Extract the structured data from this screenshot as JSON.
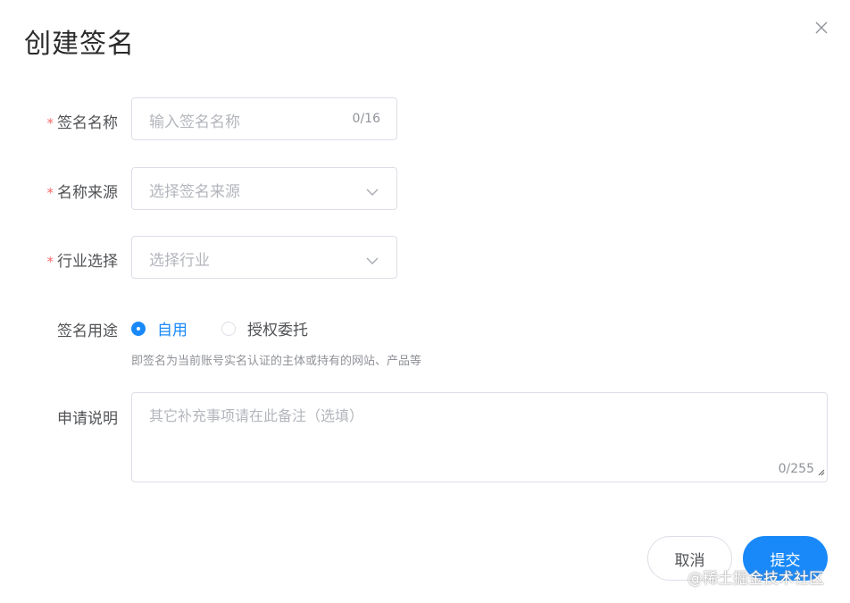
{
  "dialog": {
    "title": "创建签名"
  },
  "form": {
    "name": {
      "label": "签名名称",
      "placeholder": "输入签名名称",
      "counter": "0/16",
      "required": true
    },
    "source": {
      "label": "名称来源",
      "placeholder": "选择签名来源",
      "required": true
    },
    "industry": {
      "label": "行业选择",
      "placeholder": "选择行业",
      "required": true
    },
    "usage": {
      "label": "签名用途",
      "options": [
        {
          "label": "自用",
          "checked": true
        },
        {
          "label": "授权委托",
          "checked": false
        }
      ],
      "hint": "即签名为当前账号实名认证的主体或持有的网站、产品等"
    },
    "description": {
      "label": "申请说明",
      "placeholder": "其它补充事项请在此备注（选填）",
      "counter": "0/255"
    },
    "required_mark": "*"
  },
  "footer": {
    "cancel_label": "取消",
    "submit_label": "提交"
  },
  "watermark": "@稀土掘金技术社区",
  "colors": {
    "primary": "#1989fa",
    "required": "#f56c6c",
    "border": "#dcdfe6"
  },
  "icons": {
    "close": "close-icon",
    "select": "chevron-down-icon",
    "resize": "resize-handle-icon"
  }
}
